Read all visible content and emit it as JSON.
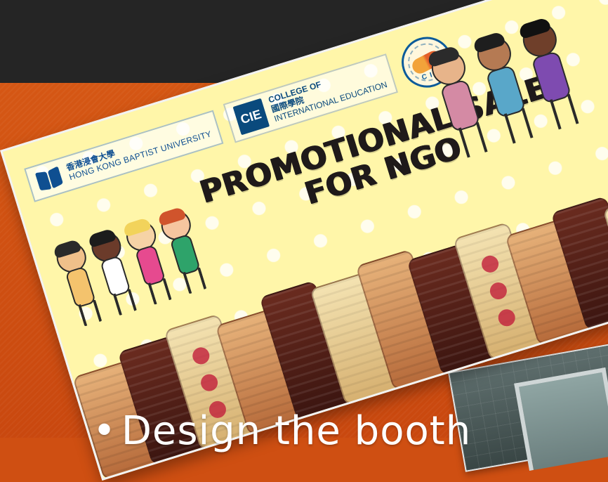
{
  "slide": {
    "banner": {
      "hkbu": {
        "zh": "香港浸會大學",
        "en": "HONG KONG BAPTIST UNIVERSITY"
      },
      "cie": {
        "mark": "CIE",
        "en_line1": "COLLEGE OF",
        "zh": "國際學院",
        "en_line2": "INTERNATIONAL EDUCATION"
      },
      "cis": {
        "mark": "C I S"
      },
      "headline": {
        "line1": "PROMOTIONAL SALE",
        "line2": "FOR NGO"
      }
    },
    "bullet_text": "Design the booth"
  },
  "colors": {
    "top_band": "#252525",
    "slide_orange": "#cf4f12",
    "banner_yellow": "#fff6a9",
    "ink_dark": "#1f1a1a",
    "hkbu_blue": "#0f4f91"
  },
  "icons": {
    "hkbu_logo": "open-book-icon",
    "cis_logo": "handshake-icon"
  }
}
